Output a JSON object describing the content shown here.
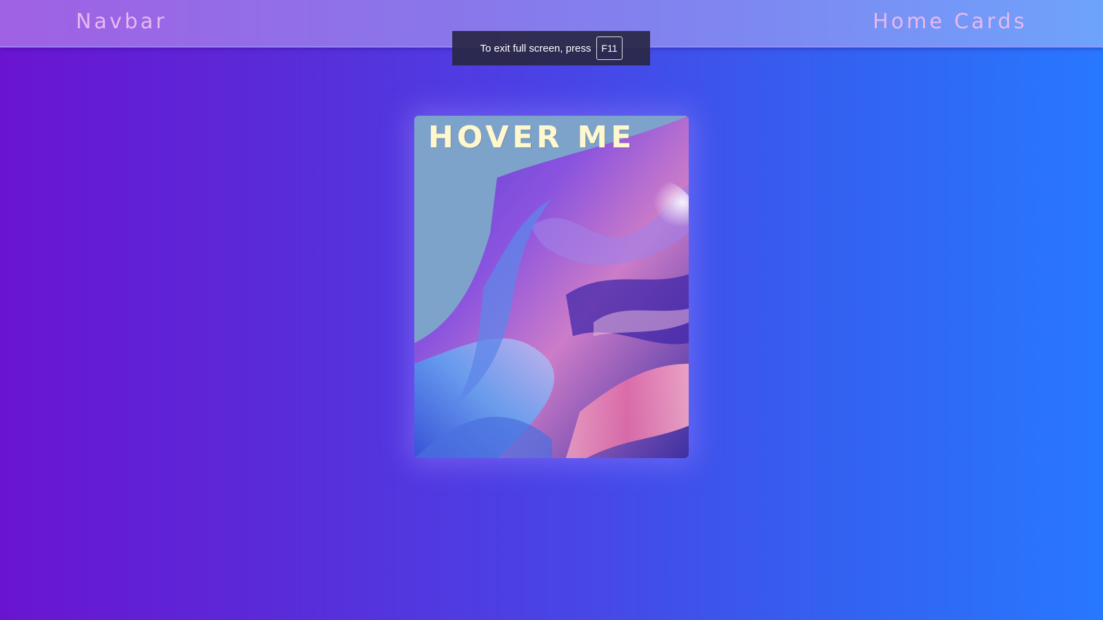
{
  "navbar": {
    "brand": "Navbar",
    "link": "Home Cards"
  },
  "fullscreen_toast": {
    "message": "To exit full screen, press",
    "key": "F11"
  },
  "card": {
    "title": "HOVER ME",
    "image": "iridescent-glass-fabric-art"
  },
  "colors": {
    "background_left": "#6a14d2",
    "background_right": "#2878ff",
    "navbar_left": "#a061e4",
    "navbar_right": "#6ea3fb",
    "nav_text": "#e9b8ef",
    "card_title": "#fff8cf",
    "card_bg": "#7ea3cb"
  }
}
